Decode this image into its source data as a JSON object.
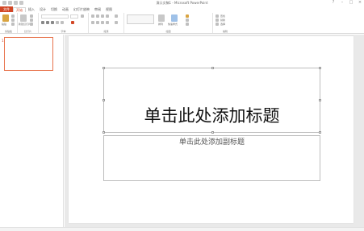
{
  "window": {
    "title": "演示文稿1 - Microsoft PowerPoint"
  },
  "tabs": [
    {
      "label": "文件"
    },
    {
      "label": "开始"
    },
    {
      "label": "插入"
    },
    {
      "label": "设计"
    },
    {
      "label": "切换"
    },
    {
      "label": "动画"
    },
    {
      "label": "幻灯片放映"
    },
    {
      "label": "审阅"
    },
    {
      "label": "视图"
    }
  ],
  "ribbon": {
    "groups": [
      {
        "label": "剪贴板"
      },
      {
        "label": "幻灯片"
      },
      {
        "label": "字体"
      },
      {
        "label": "段落"
      },
      {
        "label": "绘图"
      },
      {
        "label": "编辑"
      }
    ],
    "paste_label": "粘贴",
    "new_slide_label": "新建幻灯片",
    "arrange_label": "排列",
    "quick_styles_label": "快速样式",
    "find_label": "查找",
    "replace_label": "替换",
    "select_label": "选择"
  },
  "thumbnails": {
    "slide_number": "1"
  },
  "slide": {
    "title_placeholder": "单击此处添加标题",
    "subtitle_placeholder": "单击此处添加副标题"
  },
  "colors": {
    "accent": "#d24726",
    "thumb_border": "#e8734c"
  }
}
